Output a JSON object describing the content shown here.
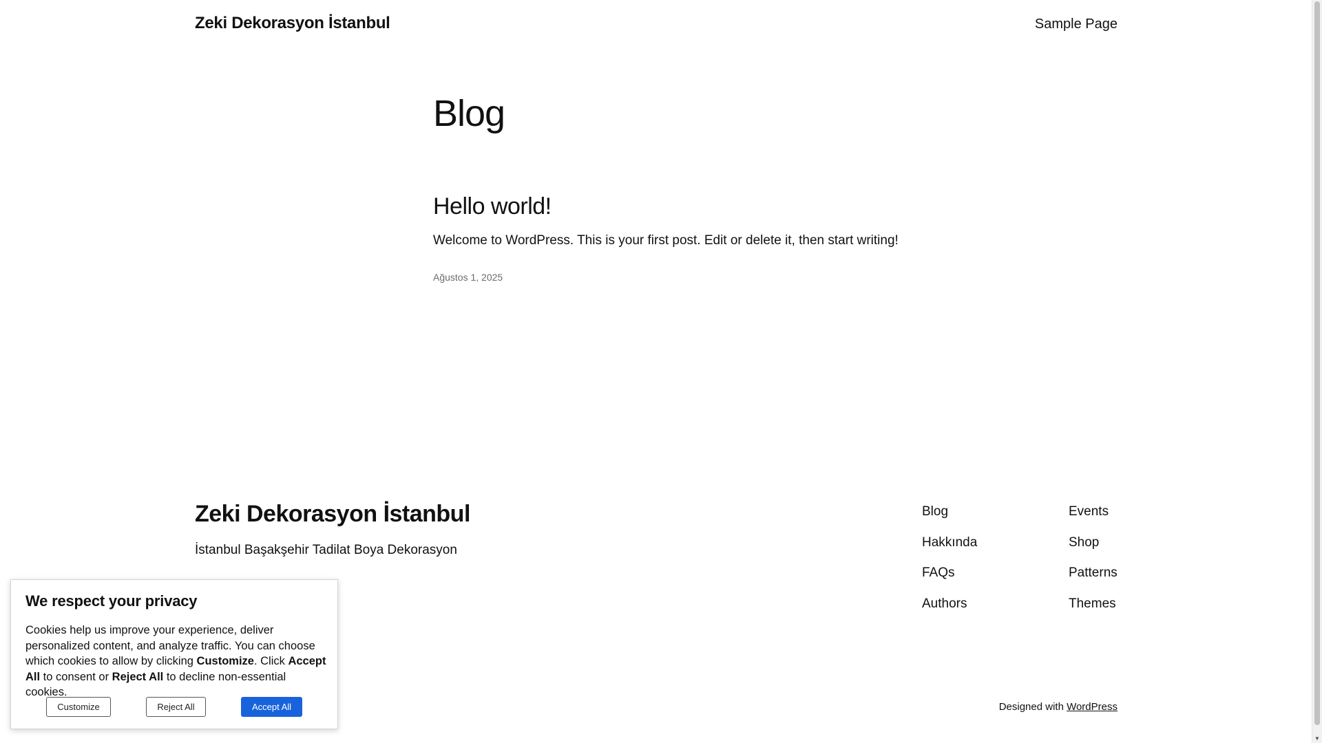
{
  "header": {
    "site_title": "Zeki Dekorasyon İstanbul",
    "nav": [
      "Sample Page"
    ]
  },
  "main": {
    "page_heading": "Blog",
    "post": {
      "title": "Hello world!",
      "excerpt": "Welcome to WordPress. This is your first post. Edit or delete it, then start writing!",
      "date": "Ağustos 1, 2025"
    }
  },
  "footer": {
    "site_title": "Zeki Dekorasyon İstanbul",
    "tagline": "İstanbul Başakşehir Tadilat Boya Dekorasyon",
    "column1": [
      "Blog",
      "Hakkında",
      "FAQs",
      "Authors"
    ],
    "column2": [
      "Events",
      "Shop",
      "Patterns",
      "Themes"
    ],
    "credits_prefix": "Designed with",
    "credits_link": "WordPress"
  },
  "cookie_banner": {
    "title": "We respect your privacy",
    "text_part1": "Cookies help us improve your experience, deliver personalized content, and analyze traffic. You can choose which cookies to allow by clicking ",
    "text_bold1": "Customize",
    "text_part2": ". Click ",
    "text_bold2": "Accept All",
    "text_part3": " to consent or ",
    "text_bold3": "Reject All",
    "text_part4": " to decline non-essential cookies.",
    "customize_label": "Customize",
    "reject_label": "Reject All",
    "accept_label": "Accept All",
    "accept_color": "#1863dc"
  }
}
